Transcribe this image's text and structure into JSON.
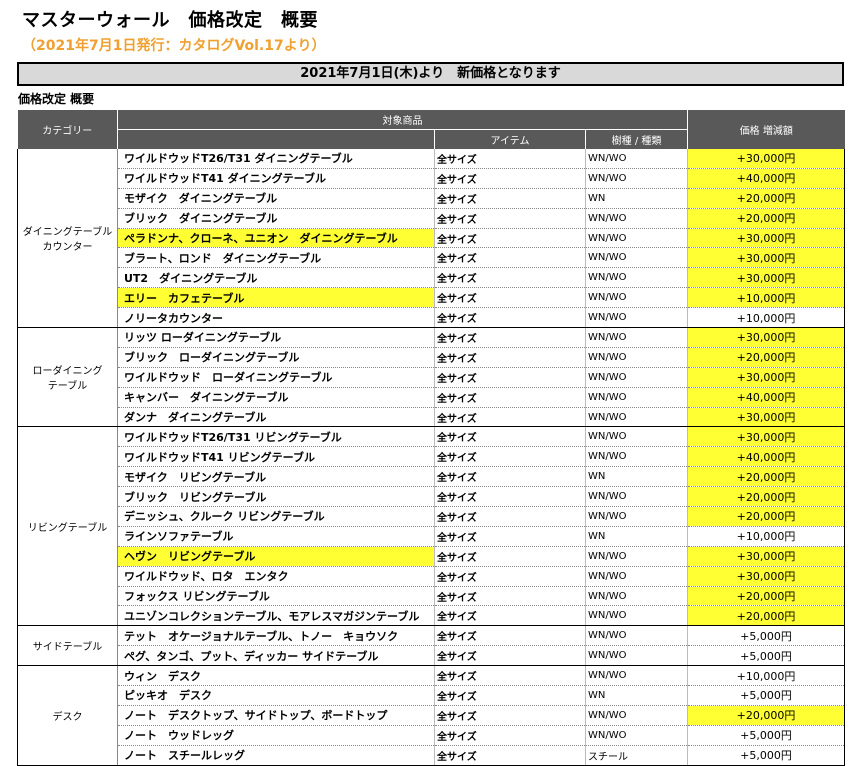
{
  "title": "マスターウォール　価格改定　概要",
  "subtitle": "（2021年7月1日発行：カタログVol.17より）",
  "banner": "2021年7月1日(木)より　新価格となります",
  "section_title": "価格改定 概要",
  "colors": {
    "highlight": "#ffff33",
    "header_bg": "#595959",
    "subtitle": "#f0a030",
    "banner_bg": "#d9d9d9"
  },
  "table": {
    "headers": {
      "category": "カテゴリー",
      "product": "対象商品",
      "item": "アイテム",
      "wood": "樹種 / 種類",
      "price": "価格 増減額"
    },
    "groups": [
      {
        "category": "ダイニングテーブル\nカウンター",
        "rows": [
          {
            "name": "ワイルドウッドT26/T31 ダイニングテーブル",
            "size": "全サイズ",
            "wood": "WN/WO",
            "price": "+30,000円",
            "price_hl": true,
            "name_hl": false
          },
          {
            "name": "ワイルドウッドT41 ダイニングテーブル",
            "size": "全サイズ",
            "wood": "WN/WO",
            "price": "+40,000円",
            "price_hl": true,
            "name_hl": false
          },
          {
            "name": "モザイク　ダイニングテーブル",
            "size": "全サイズ",
            "wood": "WN",
            "price": "+20,000円",
            "price_hl": true,
            "name_hl": false
          },
          {
            "name": "ブリック　ダイニングテーブル",
            "size": "全サイズ",
            "wood": "WN/WO",
            "price": "+20,000円",
            "price_hl": true,
            "name_hl": false
          },
          {
            "name": "ペラドンナ、クローネ、ユニオン　ダイニングテーブル",
            "size": "全サイズ",
            "wood": "WN/WO",
            "price": "+30,000円",
            "price_hl": true,
            "name_hl": true
          },
          {
            "name": "ブラート、ロンド　ダイニングテーブル",
            "size": "全サイズ",
            "wood": "WN/WO",
            "price": "+30,000円",
            "price_hl": true,
            "name_hl": false
          },
          {
            "name": "UT2　ダイニングテーブル",
            "size": "全サイズ",
            "wood": "WN/WO",
            "price": "+30,000円",
            "price_hl": true,
            "name_hl": false
          },
          {
            "name": "エリー　カフェテーブル",
            "size": "全サイズ",
            "wood": "WN/WO",
            "price": "+10,000円",
            "price_hl": true,
            "name_hl": true
          },
          {
            "name": "ノリータカウンター",
            "size": "全サイズ",
            "wood": "WN/WO",
            "price": "+10,000円",
            "price_hl": false,
            "name_hl": false
          }
        ]
      },
      {
        "category": "ローダイニング\nテーブル",
        "rows": [
          {
            "name": "リッツ ローダイニングテーブル",
            "size": "全サイズ",
            "wood": "WN/WO",
            "price": "+30,000円",
            "price_hl": true,
            "name_hl": false
          },
          {
            "name": "ブリック　ローダイニングテーブル",
            "size": "全サイズ",
            "wood": "WN/WO",
            "price": "+20,000円",
            "price_hl": true,
            "name_hl": false
          },
          {
            "name": "ワイルドウッド　ローダイニングテーブル",
            "size": "全サイズ",
            "wood": "WN/WO",
            "price": "+30,000円",
            "price_hl": true,
            "name_hl": false
          },
          {
            "name": "キャンバー　ダイニングテーブル",
            "size": "全サイズ",
            "wood": "WN/WO",
            "price": "+40,000円",
            "price_hl": true,
            "name_hl": false
          },
          {
            "name": "ダンナ　ダイニングテーブル",
            "size": "全サイズ",
            "wood": "WN/WO",
            "price": "+30,000円",
            "price_hl": true,
            "name_hl": false
          }
        ]
      },
      {
        "category": "リビングテーブル",
        "rows": [
          {
            "name": "ワイルドウッドT26/T31 リビングテーブル",
            "size": "全サイズ",
            "wood": "WN/WO",
            "price": "+30,000円",
            "price_hl": true,
            "name_hl": false
          },
          {
            "name": "ワイルドウッドT41 リビングテーブル",
            "size": "全サイズ",
            "wood": "WN/WO",
            "price": "+40,000円",
            "price_hl": true,
            "name_hl": false
          },
          {
            "name": "モザイク　リビングテーブル",
            "size": "全サイズ",
            "wood": "WN",
            "price": "+20,000円",
            "price_hl": true,
            "name_hl": false
          },
          {
            "name": "ブリック　リビングテーブル",
            "size": "全サイズ",
            "wood": "WN/WO",
            "price": "+20,000円",
            "price_hl": true,
            "name_hl": false
          },
          {
            "name": "デニッシュ、クルーク リビングテーブル",
            "size": "全サイズ",
            "wood": "WN/WO",
            "price": "+20,000円",
            "price_hl": true,
            "name_hl": false
          },
          {
            "name": "ラインソファテーブル",
            "size": "全サイズ",
            "wood": "WN",
            "price": "+10,000円",
            "price_hl": false,
            "name_hl": false
          },
          {
            "name": "ヘヴン　リビングテーブル",
            "size": "全サイズ",
            "wood": "WN/WO",
            "price": "+30,000円",
            "price_hl": true,
            "name_hl": true
          },
          {
            "name": "ワイルドウッド、ロタ　エンタク",
            "size": "全サイズ",
            "wood": "WN/WO",
            "price": "+30,000円",
            "price_hl": true,
            "name_hl": false
          },
          {
            "name": "フォックス リビングテーブル",
            "size": "全サイズ",
            "wood": "WN/WO",
            "price": "+20,000円",
            "price_hl": true,
            "name_hl": false
          },
          {
            "name": "ユニゾンコレクションテーブル、モアレスマガジンテーブル",
            "size": "全サイズ",
            "wood": "WN/WO",
            "price": "+20,000円",
            "price_hl": true,
            "name_hl": false
          }
        ]
      },
      {
        "category": "サイドテーブル",
        "rows": [
          {
            "name": "テット　オケージョナルテーブル、トノー　キョウソク",
            "size": "全サイズ",
            "wood": "WN/WO",
            "price": "+5,000円",
            "price_hl": false,
            "name_hl": false
          },
          {
            "name": "ペグ、タンゴ、プット、ディッカー サイドテーブル",
            "size": "全サイズ",
            "wood": "WN/WO",
            "price": "+5,000円",
            "price_hl": false,
            "name_hl": false
          }
        ]
      },
      {
        "category": "デスク",
        "rows": [
          {
            "name": "ウィン　デスク",
            "size": "全サイズ",
            "wood": "WN/WO",
            "price": "+10,000円",
            "price_hl": false,
            "name_hl": false
          },
          {
            "name": "ピッキオ　デスク",
            "size": "全サイズ",
            "wood": "WN",
            "price": "+5,000円",
            "price_hl": false,
            "name_hl": false
          },
          {
            "name": "ノート　デスクトップ、サイドトップ、ボードトップ",
            "size": "全サイズ",
            "wood": "WN/WO",
            "price": "+20,000円",
            "price_hl": true,
            "name_hl": false
          },
          {
            "name": "ノート　ウッドレッグ",
            "size": "全サイズ",
            "wood": "WN/WO",
            "price": "+5,000円",
            "price_hl": false,
            "name_hl": false
          },
          {
            "name": "ノート　スチールレッグ",
            "size": "全サイズ",
            "wood": "スチール",
            "price": "+5,000円",
            "price_hl": false,
            "name_hl": false
          }
        ]
      }
    ]
  }
}
